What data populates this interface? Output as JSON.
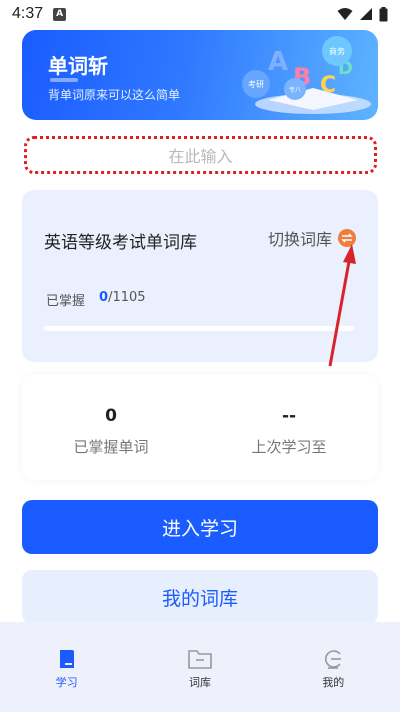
{
  "status_bar": {
    "time": "4:37",
    "notification_badge": "A"
  },
  "banner": {
    "title": "单词斩",
    "subtitle": "背单词原来可以这么简单",
    "bubbles": [
      "考研",
      "商务",
      "专八"
    ]
  },
  "search": {
    "placeholder": "在此输入"
  },
  "library": {
    "name": "英语等级考试单词库",
    "switch_label": "切换词库",
    "mastered_label": "已掌握",
    "mastered_count": "0",
    "total_text": "/1105",
    "progress_fraction": 0
  },
  "stats": {
    "mastered_value": "0",
    "mastered_label": "已掌握单词",
    "last_value": "--",
    "last_label": "上次学习至"
  },
  "buttons": {
    "start_study": "进入学习",
    "my_library": "我的词库"
  },
  "tabbar": {
    "items": [
      {
        "label": "学习",
        "active": true
      },
      {
        "label": "词库",
        "active": false
      },
      {
        "label": "我的",
        "active": false
      }
    ]
  },
  "colors": {
    "accent": "#1a5cff",
    "annotation": "#e02020",
    "switch_icon": "#f07d3c"
  }
}
